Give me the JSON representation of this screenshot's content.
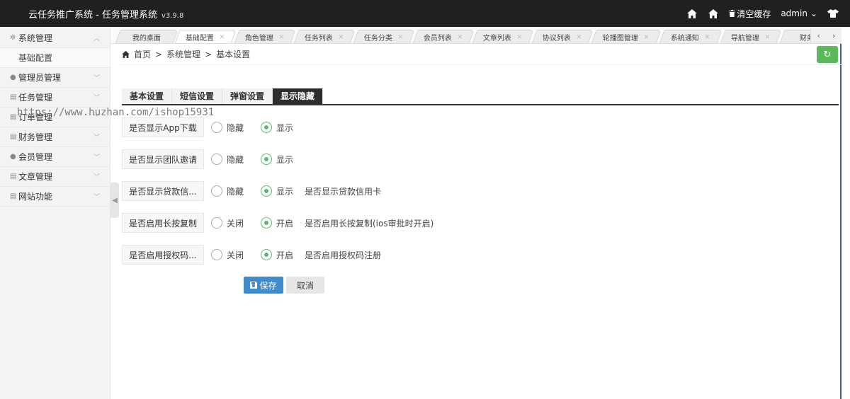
{
  "topbar": {
    "title": "云任务推广系统 - 任务管理系统",
    "version": "v3.9.8",
    "clear_cache": "清空缓存",
    "user": "admin"
  },
  "sidebar": {
    "items": [
      {
        "label": "系统管理",
        "icon": "gear-icon"
      },
      {
        "label": "基础配置"
      },
      {
        "label": "管理员管理",
        "icon": "user-icon"
      },
      {
        "label": "任务管理",
        "icon": "list-icon"
      },
      {
        "label": "订单管理",
        "icon": "list-icon"
      },
      {
        "label": "财务管理",
        "icon": "list-icon"
      },
      {
        "label": "会员管理",
        "icon": "user-icon"
      },
      {
        "label": "文章管理",
        "icon": "list-icon"
      },
      {
        "label": "网站功能",
        "icon": "list-icon"
      }
    ]
  },
  "tabs": [
    "我的桌面",
    "基础配置",
    "角色管理",
    "任务列表",
    "任务分类",
    "会员列表",
    "文章列表",
    "协议列表",
    "轮播图管理",
    "系统通知",
    "导航管理",
    "财务明"
  ],
  "breadcrumb": {
    "home": "首页",
    "sep": ">",
    "level1": "系统管理",
    "level2": "基本设置"
  },
  "subtabs": [
    "基本设置",
    "短信设置",
    "弹窗设置",
    "显示隐藏"
  ],
  "watermark": "https://www.huzhan.com/ishop15931",
  "form": {
    "rows": [
      {
        "label": "是否显示App下载",
        "opt1": "隐藏",
        "opt2": "显示",
        "desc": ""
      },
      {
        "label": "是否显示团队邀请",
        "opt1": "隐藏",
        "opt2": "显示",
        "desc": ""
      },
      {
        "label": "是否显示贷款信...",
        "opt1": "隐藏",
        "opt2": "显示",
        "desc": "是否显示贷款信用卡"
      },
      {
        "label": "是否启用长按复制",
        "opt1": "关闭",
        "opt2": "开启",
        "desc": "是否启用长按复制(ios审批时开启)"
      },
      {
        "label": "是否启用授权码...",
        "opt1": "关闭",
        "opt2": "开启",
        "desc": "是否启用授权码注册"
      }
    ],
    "save": "保存",
    "cancel": "取消"
  },
  "colors": {
    "topbar": "#202020",
    "save_button": "#428bca",
    "refresh_button": "#5cb85c",
    "radio_selected": "#5fb878"
  }
}
